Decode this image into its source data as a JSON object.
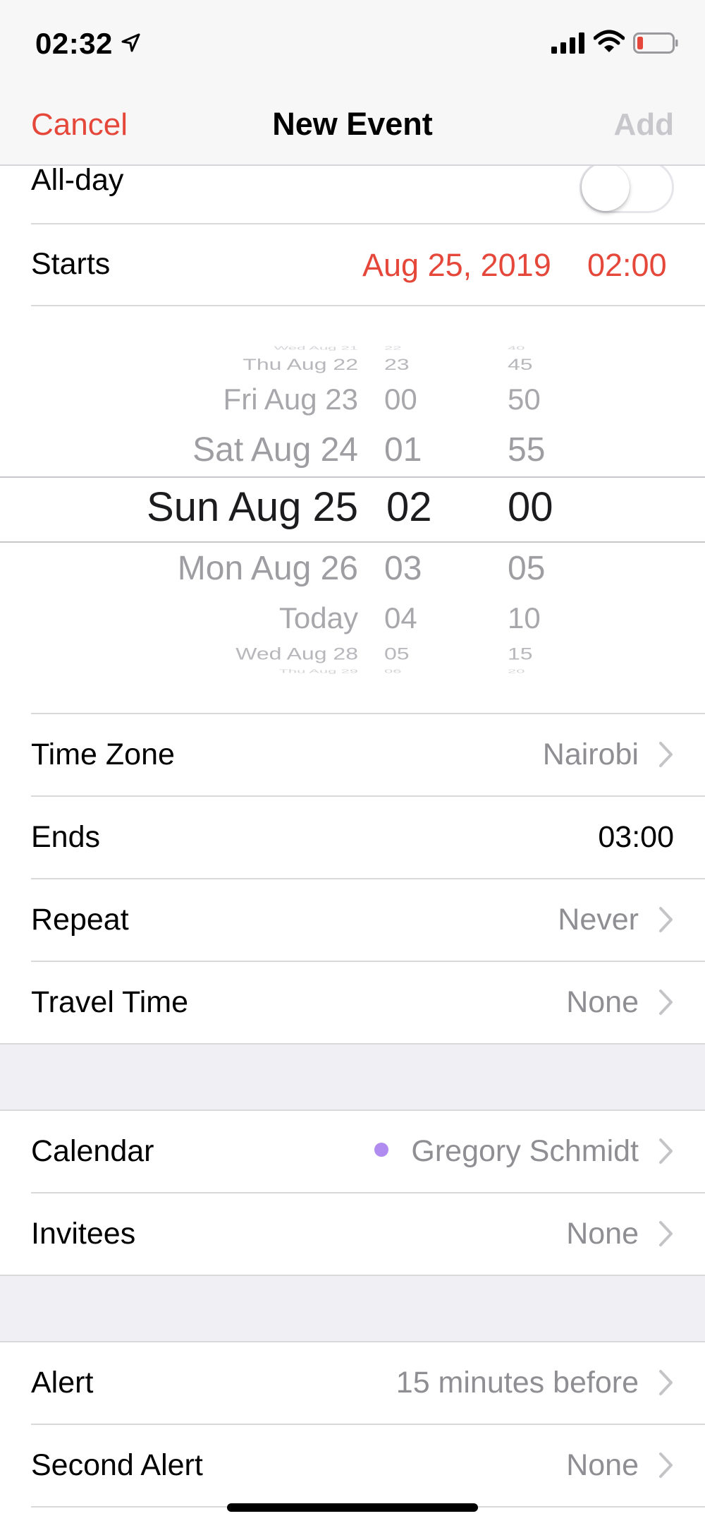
{
  "status_bar": {
    "time": "02:32",
    "icons": [
      "location-arrow-icon",
      "cellular-signal-icon",
      "wifi-icon",
      "battery-low-icon"
    ]
  },
  "nav": {
    "cancel": "Cancel",
    "title": "New Event",
    "add": "Add"
  },
  "all_day": {
    "label": "All-day",
    "enabled": false
  },
  "starts": {
    "label": "Starts",
    "date": "Aug 25, 2019",
    "time": "02:00"
  },
  "picker": {
    "dates": [
      "Wed Aug 21",
      "Thu Aug 22",
      "Fri Aug 23",
      "Sat Aug 24",
      "Sun Aug 25",
      "Mon Aug 26",
      "Today",
      "Wed Aug 28",
      "Thu Aug 29"
    ],
    "hours": [
      "22",
      "23",
      "00",
      "01",
      "02",
      "03",
      "04",
      "05",
      "06"
    ],
    "minutes": [
      "40",
      "45",
      "50",
      "55",
      "00",
      "05",
      "10",
      "15",
      "20"
    ]
  },
  "rows_group1": [
    {
      "label": "Time Zone",
      "value": "Nairobi"
    },
    {
      "label": "Ends",
      "value": "03:00"
    },
    {
      "label": "Repeat",
      "value": "Never"
    },
    {
      "label": "Travel Time",
      "value": "None"
    }
  ],
  "rows_group2": [
    {
      "label": "Calendar",
      "value": "Gregory Schmidt",
      "dot_color": "#b18cf0"
    },
    {
      "label": "Invitees",
      "value": "None"
    }
  ],
  "rows_group3": [
    {
      "label": "Alert",
      "value": "15 minutes before"
    },
    {
      "label": "Second Alert",
      "value": "None"
    }
  ],
  "colors": {
    "accent": "#e5483a",
    "secondary_text": "#8e8e93",
    "group_bg": "#efeff4"
  }
}
